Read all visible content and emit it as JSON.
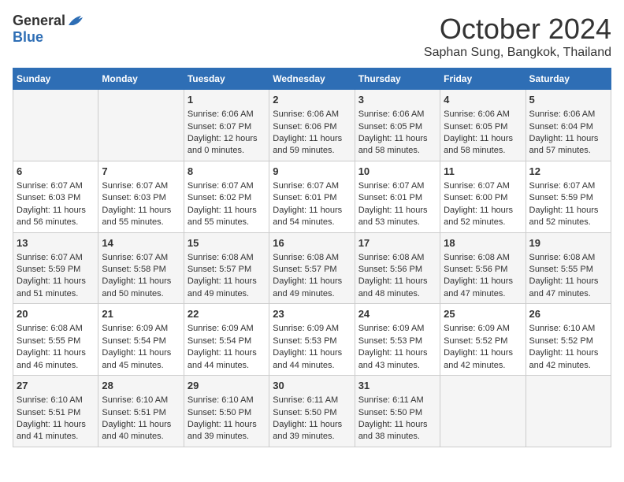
{
  "header": {
    "logo_general": "General",
    "logo_blue": "Blue",
    "month": "October 2024",
    "location": "Saphan Sung, Bangkok, Thailand"
  },
  "weekdays": [
    "Sunday",
    "Monday",
    "Tuesday",
    "Wednesday",
    "Thursday",
    "Friday",
    "Saturday"
  ],
  "weeks": [
    [
      {
        "day": "",
        "info": ""
      },
      {
        "day": "",
        "info": ""
      },
      {
        "day": "1",
        "info": "Sunrise: 6:06 AM\nSunset: 6:07 PM\nDaylight: 12 hours\nand 0 minutes."
      },
      {
        "day": "2",
        "info": "Sunrise: 6:06 AM\nSunset: 6:06 PM\nDaylight: 11 hours\nand 59 minutes."
      },
      {
        "day": "3",
        "info": "Sunrise: 6:06 AM\nSunset: 6:05 PM\nDaylight: 11 hours\nand 58 minutes."
      },
      {
        "day": "4",
        "info": "Sunrise: 6:06 AM\nSunset: 6:05 PM\nDaylight: 11 hours\nand 58 minutes."
      },
      {
        "day": "5",
        "info": "Sunrise: 6:06 AM\nSunset: 6:04 PM\nDaylight: 11 hours\nand 57 minutes."
      }
    ],
    [
      {
        "day": "6",
        "info": "Sunrise: 6:07 AM\nSunset: 6:03 PM\nDaylight: 11 hours\nand 56 minutes."
      },
      {
        "day": "7",
        "info": "Sunrise: 6:07 AM\nSunset: 6:03 PM\nDaylight: 11 hours\nand 55 minutes."
      },
      {
        "day": "8",
        "info": "Sunrise: 6:07 AM\nSunset: 6:02 PM\nDaylight: 11 hours\nand 55 minutes."
      },
      {
        "day": "9",
        "info": "Sunrise: 6:07 AM\nSunset: 6:01 PM\nDaylight: 11 hours\nand 54 minutes."
      },
      {
        "day": "10",
        "info": "Sunrise: 6:07 AM\nSunset: 6:01 PM\nDaylight: 11 hours\nand 53 minutes."
      },
      {
        "day": "11",
        "info": "Sunrise: 6:07 AM\nSunset: 6:00 PM\nDaylight: 11 hours\nand 52 minutes."
      },
      {
        "day": "12",
        "info": "Sunrise: 6:07 AM\nSunset: 5:59 PM\nDaylight: 11 hours\nand 52 minutes."
      }
    ],
    [
      {
        "day": "13",
        "info": "Sunrise: 6:07 AM\nSunset: 5:59 PM\nDaylight: 11 hours\nand 51 minutes."
      },
      {
        "day": "14",
        "info": "Sunrise: 6:07 AM\nSunset: 5:58 PM\nDaylight: 11 hours\nand 50 minutes."
      },
      {
        "day": "15",
        "info": "Sunrise: 6:08 AM\nSunset: 5:57 PM\nDaylight: 11 hours\nand 49 minutes."
      },
      {
        "day": "16",
        "info": "Sunrise: 6:08 AM\nSunset: 5:57 PM\nDaylight: 11 hours\nand 49 minutes."
      },
      {
        "day": "17",
        "info": "Sunrise: 6:08 AM\nSunset: 5:56 PM\nDaylight: 11 hours\nand 48 minutes."
      },
      {
        "day": "18",
        "info": "Sunrise: 6:08 AM\nSunset: 5:56 PM\nDaylight: 11 hours\nand 47 minutes."
      },
      {
        "day": "19",
        "info": "Sunrise: 6:08 AM\nSunset: 5:55 PM\nDaylight: 11 hours\nand 47 minutes."
      }
    ],
    [
      {
        "day": "20",
        "info": "Sunrise: 6:08 AM\nSunset: 5:55 PM\nDaylight: 11 hours\nand 46 minutes."
      },
      {
        "day": "21",
        "info": "Sunrise: 6:09 AM\nSunset: 5:54 PM\nDaylight: 11 hours\nand 45 minutes."
      },
      {
        "day": "22",
        "info": "Sunrise: 6:09 AM\nSunset: 5:54 PM\nDaylight: 11 hours\nand 44 minutes."
      },
      {
        "day": "23",
        "info": "Sunrise: 6:09 AM\nSunset: 5:53 PM\nDaylight: 11 hours\nand 44 minutes."
      },
      {
        "day": "24",
        "info": "Sunrise: 6:09 AM\nSunset: 5:53 PM\nDaylight: 11 hours\nand 43 minutes."
      },
      {
        "day": "25",
        "info": "Sunrise: 6:09 AM\nSunset: 5:52 PM\nDaylight: 11 hours\nand 42 minutes."
      },
      {
        "day": "26",
        "info": "Sunrise: 6:10 AM\nSunset: 5:52 PM\nDaylight: 11 hours\nand 42 minutes."
      }
    ],
    [
      {
        "day": "27",
        "info": "Sunrise: 6:10 AM\nSunset: 5:51 PM\nDaylight: 11 hours\nand 41 minutes."
      },
      {
        "day": "28",
        "info": "Sunrise: 6:10 AM\nSunset: 5:51 PM\nDaylight: 11 hours\nand 40 minutes."
      },
      {
        "day": "29",
        "info": "Sunrise: 6:10 AM\nSunset: 5:50 PM\nDaylight: 11 hours\nand 39 minutes."
      },
      {
        "day": "30",
        "info": "Sunrise: 6:11 AM\nSunset: 5:50 PM\nDaylight: 11 hours\nand 39 minutes."
      },
      {
        "day": "31",
        "info": "Sunrise: 6:11 AM\nSunset: 5:50 PM\nDaylight: 11 hours\nand 38 minutes."
      },
      {
        "day": "",
        "info": ""
      },
      {
        "day": "",
        "info": ""
      }
    ]
  ]
}
